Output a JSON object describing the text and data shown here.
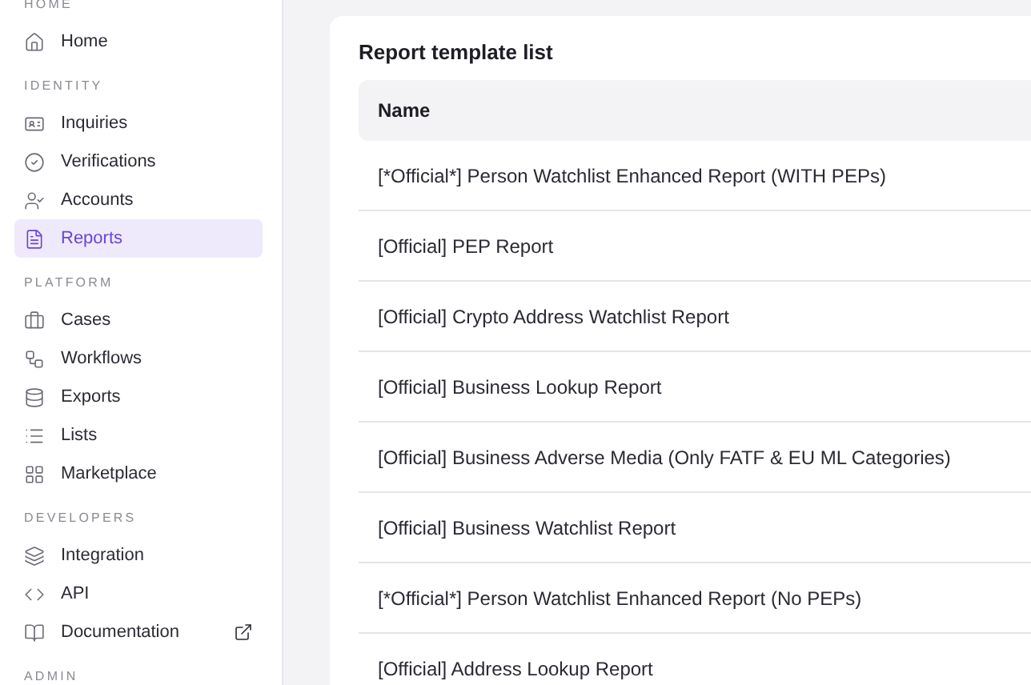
{
  "sidebar": {
    "sections": [
      {
        "label": "HOME",
        "items": [
          {
            "label": "Home",
            "selected": false,
            "external": false
          }
        ]
      },
      {
        "label": "IDENTITY",
        "items": [
          {
            "label": "Inquiries",
            "selected": false,
            "external": false
          },
          {
            "label": "Verifications",
            "selected": false,
            "external": false
          },
          {
            "label": "Accounts",
            "selected": false,
            "external": false
          },
          {
            "label": "Reports",
            "selected": true,
            "external": false
          }
        ]
      },
      {
        "label": "PLATFORM",
        "items": [
          {
            "label": "Cases",
            "selected": false,
            "external": false
          },
          {
            "label": "Workflows",
            "selected": false,
            "external": false
          },
          {
            "label": "Exports",
            "selected": false,
            "external": false
          },
          {
            "label": "Lists",
            "selected": false,
            "external": false
          },
          {
            "label": "Marketplace",
            "selected": false,
            "external": false
          }
        ]
      },
      {
        "label": "DEVELOPERS",
        "items": [
          {
            "label": "Integration",
            "selected": false,
            "external": false
          },
          {
            "label": "API",
            "selected": false,
            "external": false
          },
          {
            "label": "Documentation",
            "selected": false,
            "external": true
          }
        ]
      },
      {
        "label": "ADMIN"
      }
    ]
  },
  "card": {
    "title": "Report template list",
    "table": {
      "columns": [
        "Name"
      ],
      "rows": [
        [
          "[*Official*] Person Watchlist Enhanced Report (WITH PEPs)"
        ],
        [
          "[Official] PEP Report"
        ],
        [
          "[Official] Crypto Address Watchlist Report"
        ],
        [
          "[Official] Business Lookup Report"
        ],
        [
          "[Official] Business Adverse Media (Only FATF & EU ML Categories)"
        ],
        [
          "[Official] Business Watchlist Report"
        ],
        [
          "[*Official*] Person Watchlist Enhanced Report (No PEPs)"
        ],
        [
          "[Official] Address Lookup Report"
        ]
      ]
    }
  }
}
